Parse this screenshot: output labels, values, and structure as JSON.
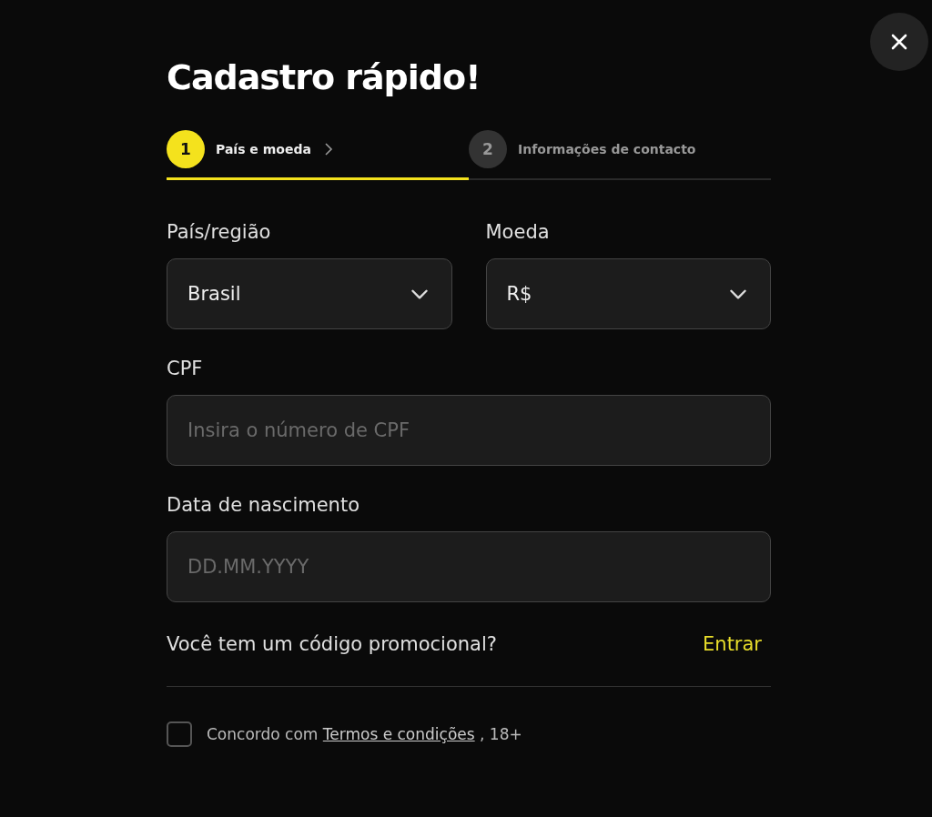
{
  "title": "Cadastro rápido!",
  "steps": [
    {
      "number": "1",
      "label": "País e moeda",
      "selected": true
    },
    {
      "number": "2",
      "label": "Informações de contacto",
      "selected": false
    }
  ],
  "selects": [
    {
      "label": "País/região",
      "value": "Brasil"
    },
    {
      "label": "Moeda",
      "value": "R$"
    }
  ],
  "fields": [
    {
      "label": "CPF",
      "placeholder": "Insira o número de CPF"
    },
    {
      "label": "Data de nascimento",
      "placeholder": "DD.MM.YYYY"
    }
  ],
  "promo": {
    "question": "Você tem um código promocional?",
    "action": "Entrar"
  },
  "agreement": {
    "checked": false,
    "before": "Concordo com",
    "link": "Termos e condições",
    "after": ", 18+"
  }
}
